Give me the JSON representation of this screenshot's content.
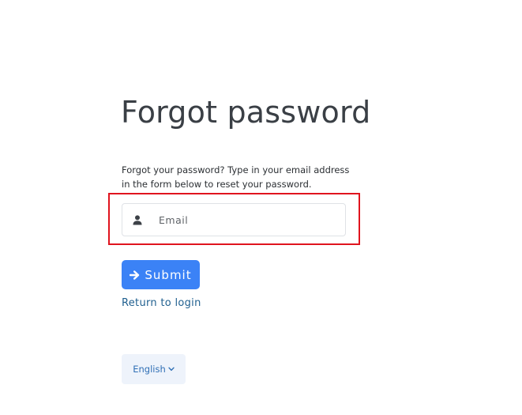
{
  "page": {
    "title": "Forgot password",
    "description": "Forgot your password? Type in your email address in the form below to reset your password."
  },
  "form": {
    "email": {
      "placeholder": "Email",
      "value": "",
      "icon": "user-icon"
    },
    "submit": {
      "label": "Submit",
      "icon": "arrow-right-icon",
      "color": "#3b82f6"
    },
    "return_link": "Return to login"
  },
  "language": {
    "selected": "English",
    "icon": "chevron-down-icon"
  },
  "colors": {
    "highlight_border": "#e0141e",
    "link": "#1f5f8f",
    "language_text": "#2f6fb5",
    "language_bg": "#eef3fb"
  }
}
